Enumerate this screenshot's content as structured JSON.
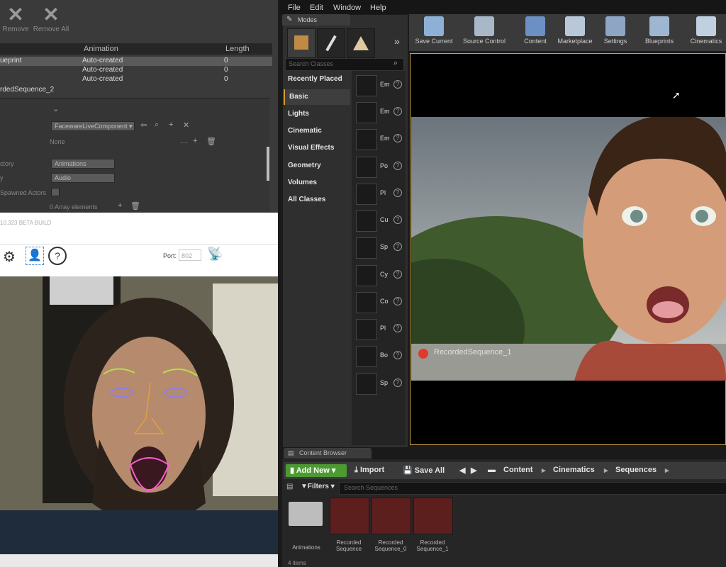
{
  "recorder": {
    "remove_label": "Remove",
    "remove_all_label": "Remove All",
    "columns": {
      "animation": "Animation",
      "length": "Length"
    },
    "rows": [
      {
        "name": "ueprint",
        "animation": "Auto-created",
        "length": "0"
      },
      {
        "name": "",
        "animation": "Auto-created",
        "length": "0"
      },
      {
        "name": "",
        "animation": "Auto-created",
        "length": "0"
      }
    ],
    "sequence_name": "rdedSequence_2",
    "component_value": "FacewareLiveComponent",
    "none_label": "None",
    "directory_label": "ctory",
    "directory_value": "Animations",
    "audio_label": "y",
    "audio_value": "Audio",
    "spawned_label": "Spawned Actors",
    "array_label": "0 Array elements"
  },
  "faceware": {
    "build": "10.323 BETA BUILD",
    "port_label": "Port:",
    "port_value": "802"
  },
  "menu": [
    "File",
    "Edit",
    "Window",
    "Help"
  ],
  "modes": {
    "tab_label": "Modes",
    "search_placeholder": "Search Classes",
    "categories": [
      "Recently Placed",
      "Basic",
      "Lights",
      "Cinematic",
      "Visual Effects",
      "Geometry",
      "Volumes",
      "All Classes"
    ],
    "selected_category": "Basic",
    "items": [
      "Em",
      "Em",
      "Em",
      "Po",
      "Pl",
      "Cu",
      "Sp",
      "Cy",
      "Co",
      "Pl",
      "Bo",
      "Sp"
    ]
  },
  "toolbar": [
    "Save Current",
    "Source Control",
    "Content",
    "Marketplace",
    "Settings",
    "Blueprints",
    "Cinematics"
  ],
  "viewport": {
    "recording_label": "RecordedSequence_1"
  },
  "content_browser": {
    "tab_label": "Content Browser",
    "add_new": "Add New",
    "import": "Import",
    "save_all": "Save All",
    "breadcrumb": [
      "Content",
      "Cinematics",
      "Sequences"
    ],
    "filters": "Filters",
    "search_placeholder": "Search Sequences",
    "assets": [
      "Animations",
      "Recorded Sequence",
      "Recorded Sequence_0",
      "Recorded Sequence_1"
    ],
    "item_count": "4 items"
  },
  "colors": {
    "accent": "#4c9b32",
    "record": "#e03a2c",
    "viewport_border": "#c8a14a"
  }
}
